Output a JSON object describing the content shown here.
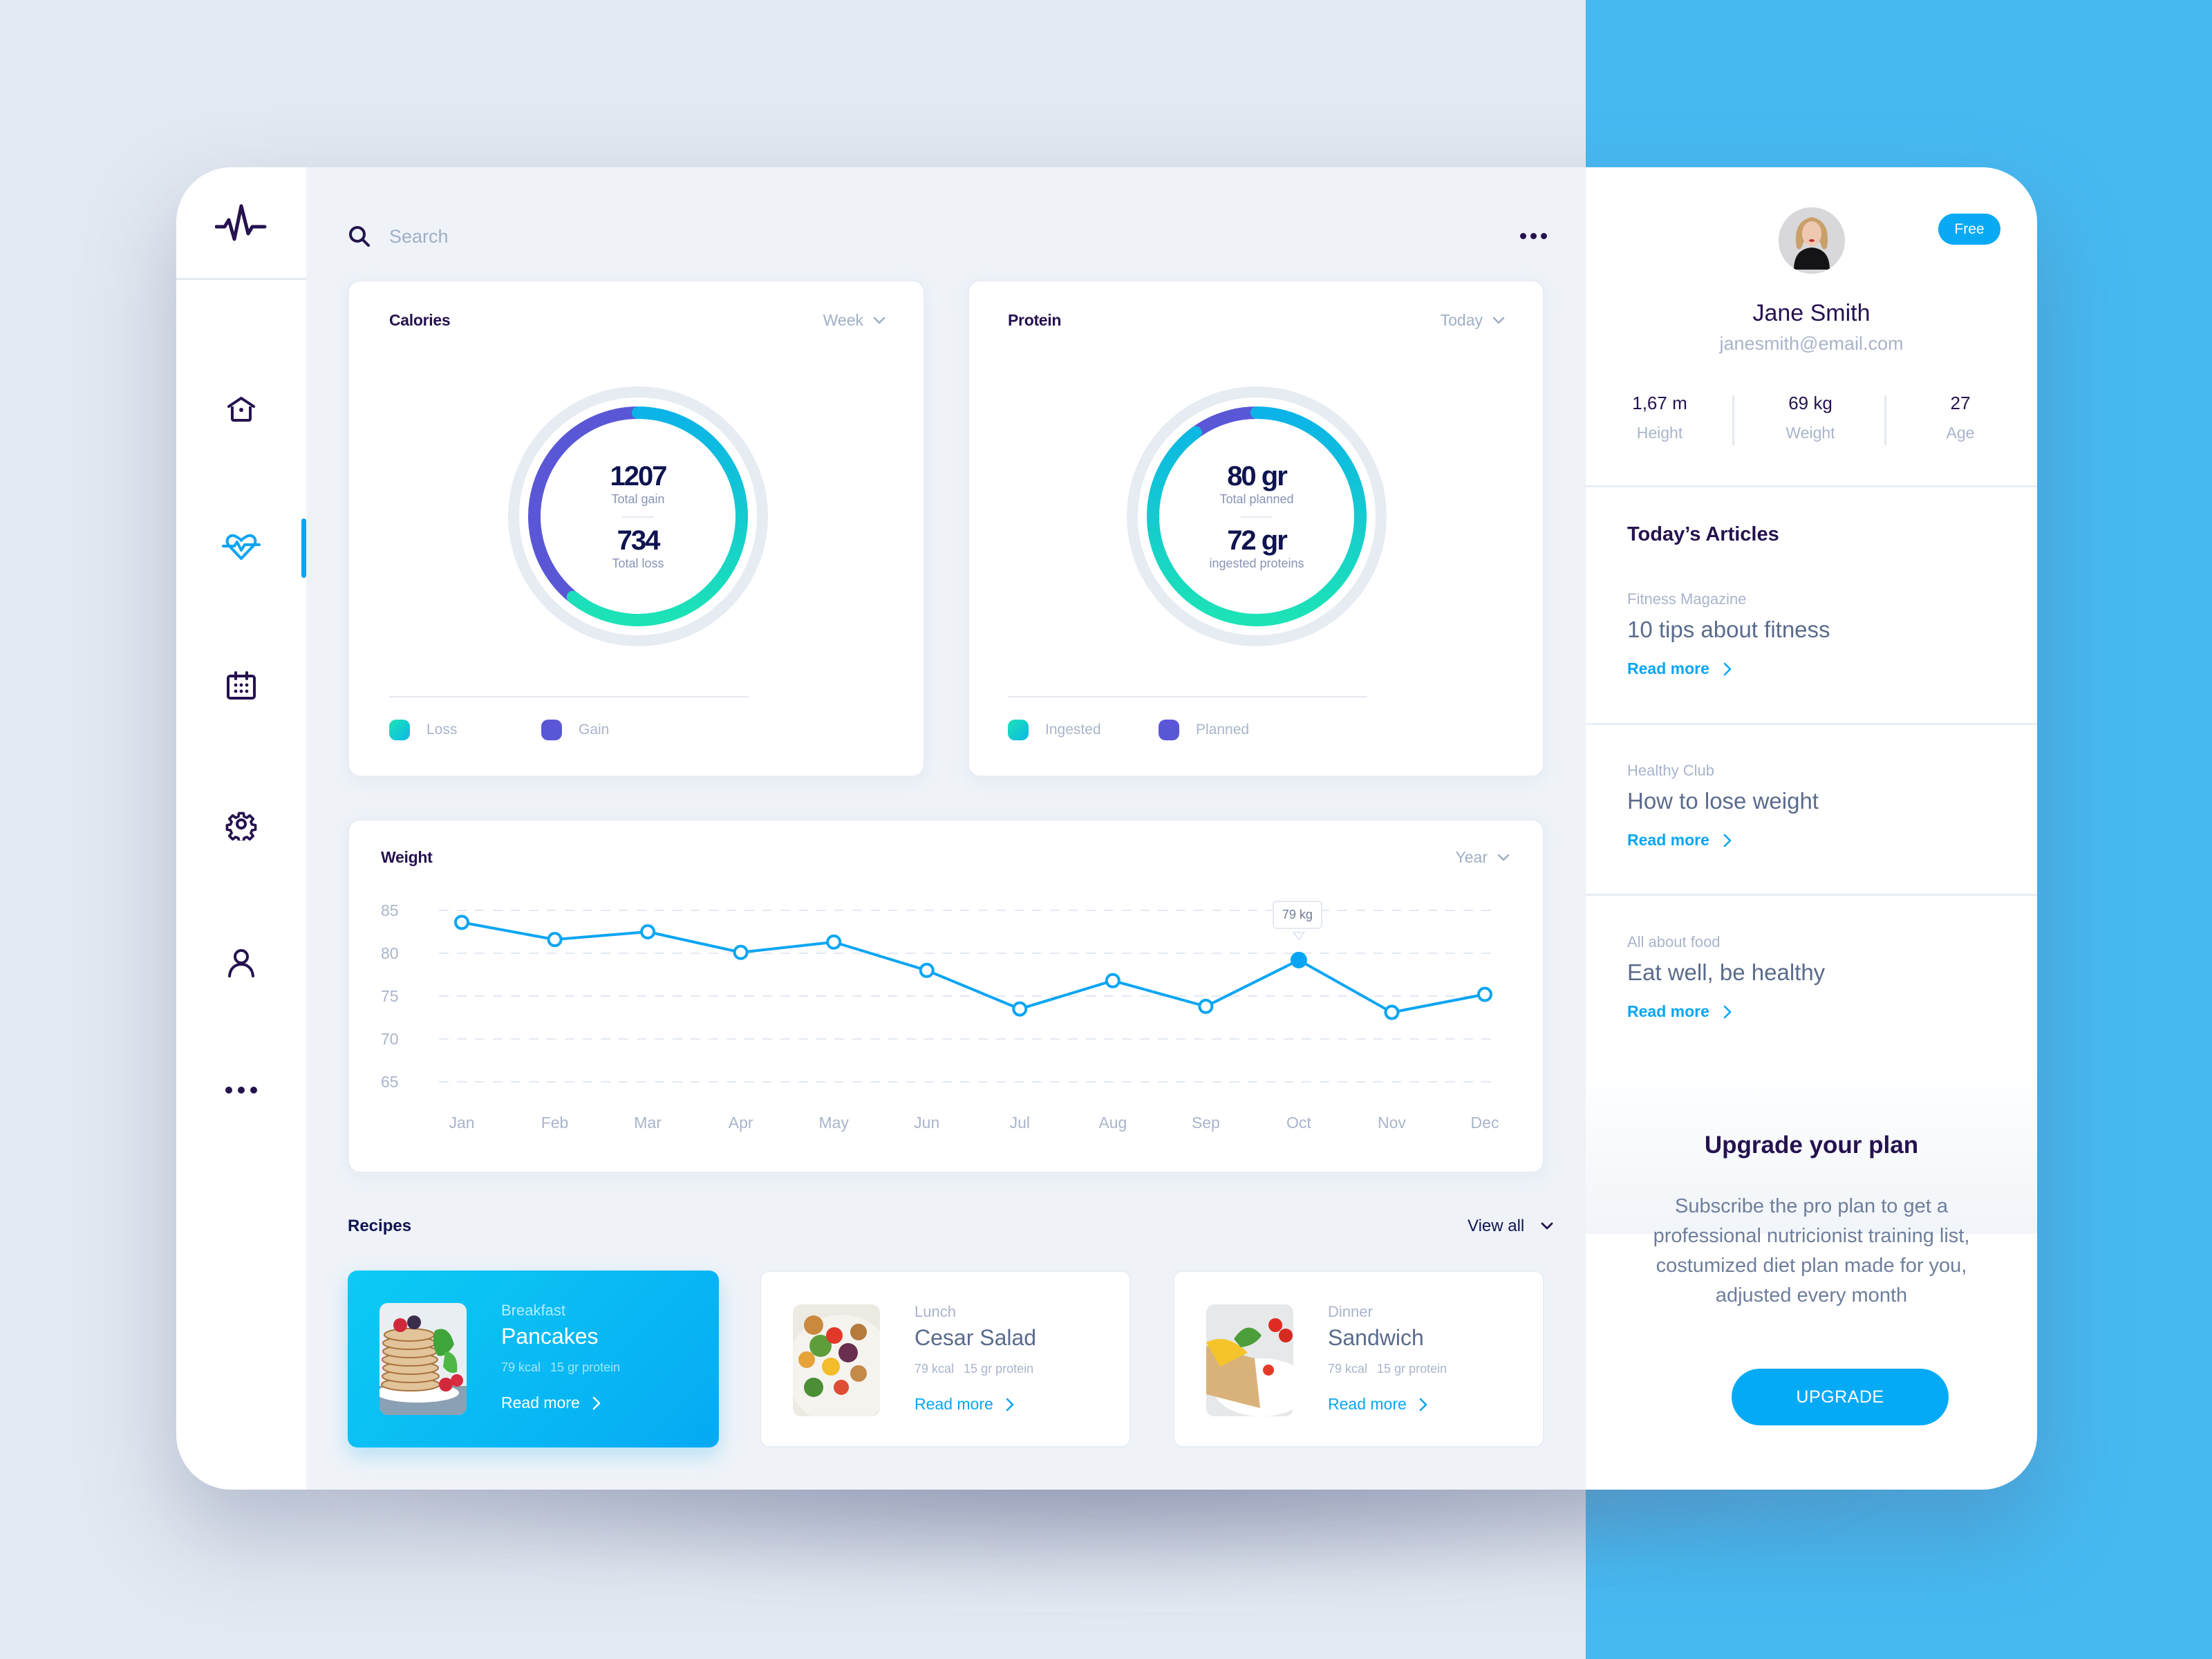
{
  "header": {
    "search_placeholder": "Search",
    "search_value": ""
  },
  "sidebar": {
    "items": [
      {
        "name": "home",
        "icon": "home-icon",
        "active": false
      },
      {
        "name": "health",
        "icon": "heart-pulse-icon",
        "active": true
      },
      {
        "name": "calendar",
        "icon": "calendar-icon",
        "active": false
      },
      {
        "name": "settings",
        "icon": "gear-icon",
        "active": false
      },
      {
        "name": "profile",
        "icon": "user-icon",
        "active": false
      },
      {
        "name": "more",
        "icon": "more-dots-icon",
        "active": false
      }
    ]
  },
  "calories": {
    "title": "Calories",
    "period": "Week",
    "total_gain_value": "1207",
    "total_gain_label": "Total gain",
    "total_loss_value": "734",
    "total_loss_label": "Total loss",
    "legend": [
      "Loss",
      "Gain"
    ]
  },
  "protein": {
    "title": "Protein",
    "period": "Today",
    "planned_value": "80 gr",
    "planned_label": "Total planned",
    "ingested_value": "72 gr",
    "ingested_label": "ingested proteins",
    "legend": [
      "Ingested",
      "Planned"
    ]
  },
  "weight": {
    "title": "Weight",
    "period": "Year",
    "tooltip": "79 kg"
  },
  "chart_data": [
    {
      "type": "pie",
      "title": "Calories",
      "variant": "donut",
      "categories": [
        "Loss",
        "Gain"
      ],
      "values": [
        734,
        1207
      ],
      "loss_fraction_of_ring": 0.608,
      "colors": {
        "Loss": "#1DE3B6 to #0BB3E8 gradient",
        "Gain": "#5A57D6"
      }
    },
    {
      "type": "pie",
      "title": "Protein",
      "variant": "donut",
      "categories": [
        "Ingested",
        "Planned"
      ],
      "values": [
        72,
        80
      ],
      "ingested_fraction_of_ring": 0.9,
      "colors": {
        "Ingested": "#1DE3B6 to #0BB3E8 gradient",
        "Planned": "#5A57D6"
      }
    },
    {
      "type": "line",
      "title": "Weight",
      "x": [
        "Jan",
        "Feb",
        "Mar",
        "Apr",
        "May",
        "Jun",
        "Jul",
        "Aug",
        "Sep",
        "Oct",
        "Nov",
        "Dec"
      ],
      "series": [
        {
          "name": "Weight (kg)",
          "values": [
            83.6,
            81.6,
            82.5,
            80.1,
            81.3,
            78.0,
            73.5,
            76.8,
            73.8,
            79.2,
            73.1,
            75.2
          ],
          "color": "#0AA5F2"
        }
      ],
      "yticks": [
        85,
        80,
        75,
        70,
        65
      ],
      "ylim": [
        65,
        85
      ],
      "grid": true,
      "highlight": {
        "index": 9,
        "label": "79 kg"
      },
      "xlabel": "",
      "ylabel": ""
    }
  ],
  "recipes": {
    "title": "Recipes",
    "view_all": "View all",
    "items": [
      {
        "category": "Breakfast",
        "name": "Pancakes",
        "kcal": "79 kcal",
        "protein": "15 gr protein",
        "link": "Read more",
        "active": true
      },
      {
        "category": "Lunch",
        "name": "Cesar Salad",
        "kcal": "79 kcal",
        "protein": "15 gr protein",
        "link": "Read more",
        "active": false
      },
      {
        "category": "Dinner",
        "name": "Sandwich",
        "kcal": "79 kcal",
        "protein": "15 gr protein",
        "link": "Read more",
        "active": false
      }
    ]
  },
  "profile": {
    "badge": "Free",
    "name": "Jane Smith",
    "email": "janesmith@email.com",
    "stats": [
      {
        "value": "1,67 m",
        "label": "Height"
      },
      {
        "value": "69 kg",
        "label": "Weight"
      },
      {
        "value": "27",
        "label": "Age"
      }
    ]
  },
  "articles": {
    "title": "Today’s Articles",
    "items": [
      {
        "source": "Fitness Magazine",
        "title": "10 tips about fitness",
        "link": "Read more"
      },
      {
        "source": "Healthy Club",
        "title": "How to lose weight",
        "link": "Read more"
      },
      {
        "source": "All about food",
        "title": "Eat well, be healthy",
        "link": "Read more"
      }
    ]
  },
  "upgrade": {
    "title": "Upgrade your plan",
    "text": "Subscribe the pro plan to get a professional nutricionist training list, costumized diet plan made for you, adjusted every month",
    "button": "UPGRADE"
  },
  "colors": {
    "accent": "#0AA5F2",
    "navy": "#25124F",
    "gain_purple": "#5A57D6",
    "loss_teal": "#1DE3B6",
    "page_bg_left": "#E3E9F1",
    "page_bg_right": "#46B9F1"
  }
}
